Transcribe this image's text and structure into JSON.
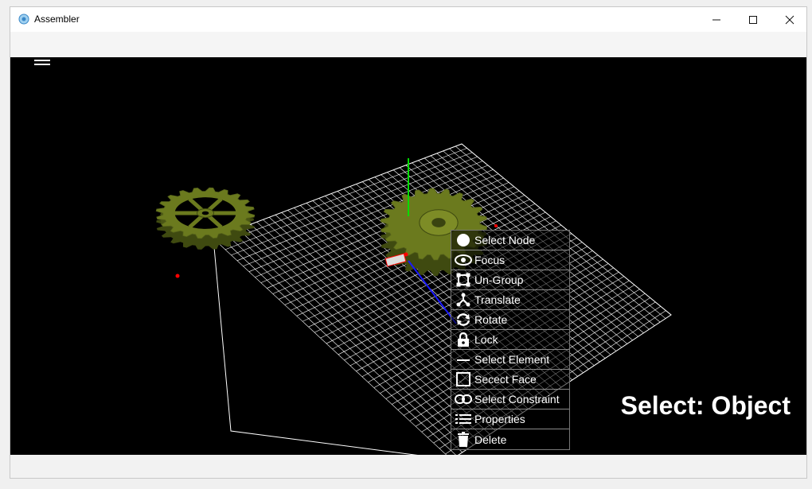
{
  "window": {
    "title": "Assembler",
    "minimize_glyph": "—",
    "maximize_glyph": "☐",
    "close_glyph": "✕"
  },
  "viewport": {
    "background": "#000000",
    "mode_label": "Select: Object",
    "gear_color": "#6b7a1e",
    "grid_color": "#ffffff",
    "axis_colors": {
      "y": "#00dd00",
      "z": "#1a1aff",
      "marker": "#ff0000"
    }
  },
  "context_menu": {
    "items": [
      {
        "label": "Select Node",
        "icon": "circle-icon"
      },
      {
        "label": "Focus",
        "icon": "eye-icon"
      },
      {
        "label": "Un-Group",
        "icon": "ungroup-icon"
      },
      {
        "label": "Translate",
        "icon": "translate-icon"
      },
      {
        "label": "Rotate",
        "icon": "rotate-icon"
      },
      {
        "label": "Lock",
        "icon": "lock-icon"
      },
      {
        "label": "Select Element",
        "icon": "line-icon"
      },
      {
        "label": "Secect Face",
        "icon": "face-icon"
      },
      {
        "label": "Select Constraint",
        "icon": "link-icon"
      },
      {
        "label": "Properties",
        "icon": "list-icon"
      },
      {
        "label": "Delete",
        "icon": "trash-icon"
      }
    ]
  }
}
